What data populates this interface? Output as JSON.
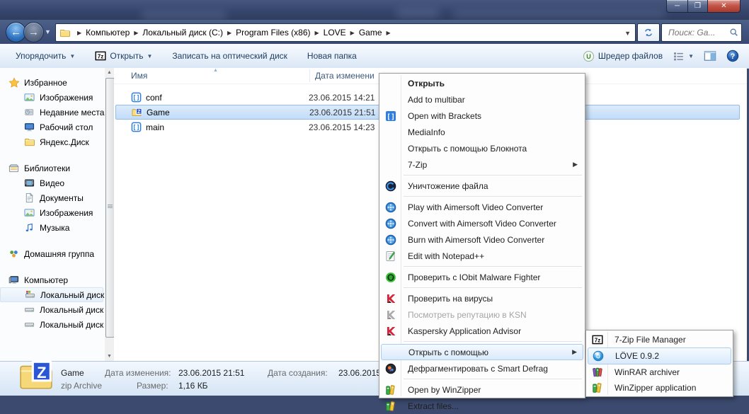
{
  "window": {
    "buttons": {
      "minimize": "─",
      "maximize": "❐",
      "close": "✕"
    }
  },
  "navbar": {
    "breadcrumb": [
      "Компьютер",
      "Локальный диск (C:)",
      "Program Files (x86)",
      "LOVE",
      "Game"
    ],
    "search": {
      "placeholder": "Поиск: Ga..."
    }
  },
  "toolbar": {
    "items": [
      {
        "label": "Упорядочить",
        "dropdown": true,
        "icon": null
      },
      {
        "label": "Открыть",
        "dropdown": true,
        "icon": "sevenzip-icon"
      },
      {
        "label": "Записать на оптический диск",
        "dropdown": false,
        "icon": null
      },
      {
        "label": "Новая папка",
        "dropdown": false,
        "icon": null
      }
    ],
    "right": {
      "shredder_label": "Шредер файлов"
    }
  },
  "sidebar": {
    "groups": [
      {
        "label": "Избранное",
        "icon": "star-icon",
        "items": [
          {
            "label": "Изображения",
            "icon": "pictures-icon"
          },
          {
            "label": "Недавние места",
            "icon": "recent-places-icon"
          },
          {
            "label": "Рабочий стол",
            "icon": "desktop-icon"
          },
          {
            "label": "Яндекс.Диск",
            "icon": "folder-icon"
          }
        ]
      },
      {
        "label": "Библиотеки",
        "icon": "libraries-icon",
        "items": [
          {
            "label": "Видео",
            "icon": "video-icon"
          },
          {
            "label": "Документы",
            "icon": "documents-icon"
          },
          {
            "label": "Изображения",
            "icon": "pictures-icon"
          },
          {
            "label": "Музыка",
            "icon": "music-icon"
          }
        ]
      },
      {
        "label": "Домашняя группа",
        "icon": "homegroup-icon",
        "items": []
      },
      {
        "label": "Компьютер",
        "icon": "computer-icon",
        "items": [
          {
            "label": "Локальный диск",
            "icon": "system-drive-icon",
            "hover": true
          },
          {
            "label": "Локальный диск",
            "icon": "drive-icon"
          },
          {
            "label": "Локальный диск",
            "icon": "drive-icon"
          }
        ]
      }
    ]
  },
  "filelist": {
    "columns": {
      "name": "Имя",
      "modified": "Дата изменени"
    },
    "rows": [
      {
        "name": "conf",
        "icon": "lua-file-icon",
        "modified": "23.06.2015 14:21",
        "selected": false
      },
      {
        "name": "Game",
        "icon": "zip-folder-icon",
        "modified": "23.06.2015 21:51",
        "selected": true
      },
      {
        "name": "main",
        "icon": "lua-file-icon",
        "modified": "23.06.2015 14:23",
        "selected": false
      }
    ]
  },
  "context_menu": {
    "items": [
      {
        "label": "Открыть",
        "icon": null,
        "bold": true
      },
      {
        "label": "Add to multibar",
        "icon": null
      },
      {
        "label": "Open with Brackets",
        "icon": "brackets-icon"
      },
      {
        "label": "MediaInfo",
        "icon": null
      },
      {
        "label": "Открыть с помощью Блокнота",
        "icon": null
      },
      {
        "label": "7-Zip",
        "icon": null,
        "submenu": true,
        "sep_after": true
      },
      {
        "label": "Уничтожение файла",
        "icon": "file-shredder-icon",
        "sep_after": true
      },
      {
        "label": "Play with Aimersoft Video Converter",
        "icon": "aimersoft-icon"
      },
      {
        "label": "Convert with Aimersoft Video Converter",
        "icon": "aimersoft-icon"
      },
      {
        "label": "Burn with Aimersoft Video Converter",
        "icon": "aimersoft-icon"
      },
      {
        "label": "Edit with Notepad++",
        "icon": "notepadpp-icon",
        "sep_after": true
      },
      {
        "label": "Проверить с IObit Malware Fighter",
        "icon": "iobit-icon",
        "sep_after": true
      },
      {
        "label": "Проверить на вирусы",
        "icon": "kaspersky-icon"
      },
      {
        "label": "Посмотреть репутацию в KSN",
        "icon": "kaspersky-gray-icon",
        "disabled": true
      },
      {
        "label": "Kaspersky Application Advisor",
        "icon": "kaspersky-icon",
        "sep_after": true
      },
      {
        "label": "Открыть с помощью",
        "icon": null,
        "submenu": true,
        "highlighted": true
      },
      {
        "label": "Дефрагментировать с Smart Defrag",
        "icon": "smart-defrag-icon",
        "sep_after": true
      },
      {
        "label": "Open by WinZipper",
        "icon": "winzipper-icon"
      },
      {
        "label": "Extract files...",
        "icon": "winzipper-icon"
      }
    ]
  },
  "open_with_submenu": {
    "items": [
      {
        "label": "7-Zip File Manager",
        "icon": "sevenzip-icon"
      },
      {
        "label": "LÖVE 0.9.2",
        "icon": "love-icon",
        "highlighted": true
      },
      {
        "label": "WinRAR archiver",
        "icon": "winrar-icon"
      },
      {
        "label": "WinZipper application",
        "icon": "winzipper-icon"
      }
    ]
  },
  "details_pane": {
    "name": "Game",
    "type": "zip Archive",
    "modified_label": "Дата изменения:",
    "modified_value": "23.06.2015 21:51",
    "size_label": "Размер:",
    "size_value": "1,16 КБ",
    "created_label": "Дата создания:",
    "created_value": "23.06.2015"
  },
  "colors": {
    "selection_border": "#8fbce8",
    "menu_highlight_border": "#a9cdf0",
    "close_button": "#c4574a",
    "titlebar": "#35446a"
  }
}
